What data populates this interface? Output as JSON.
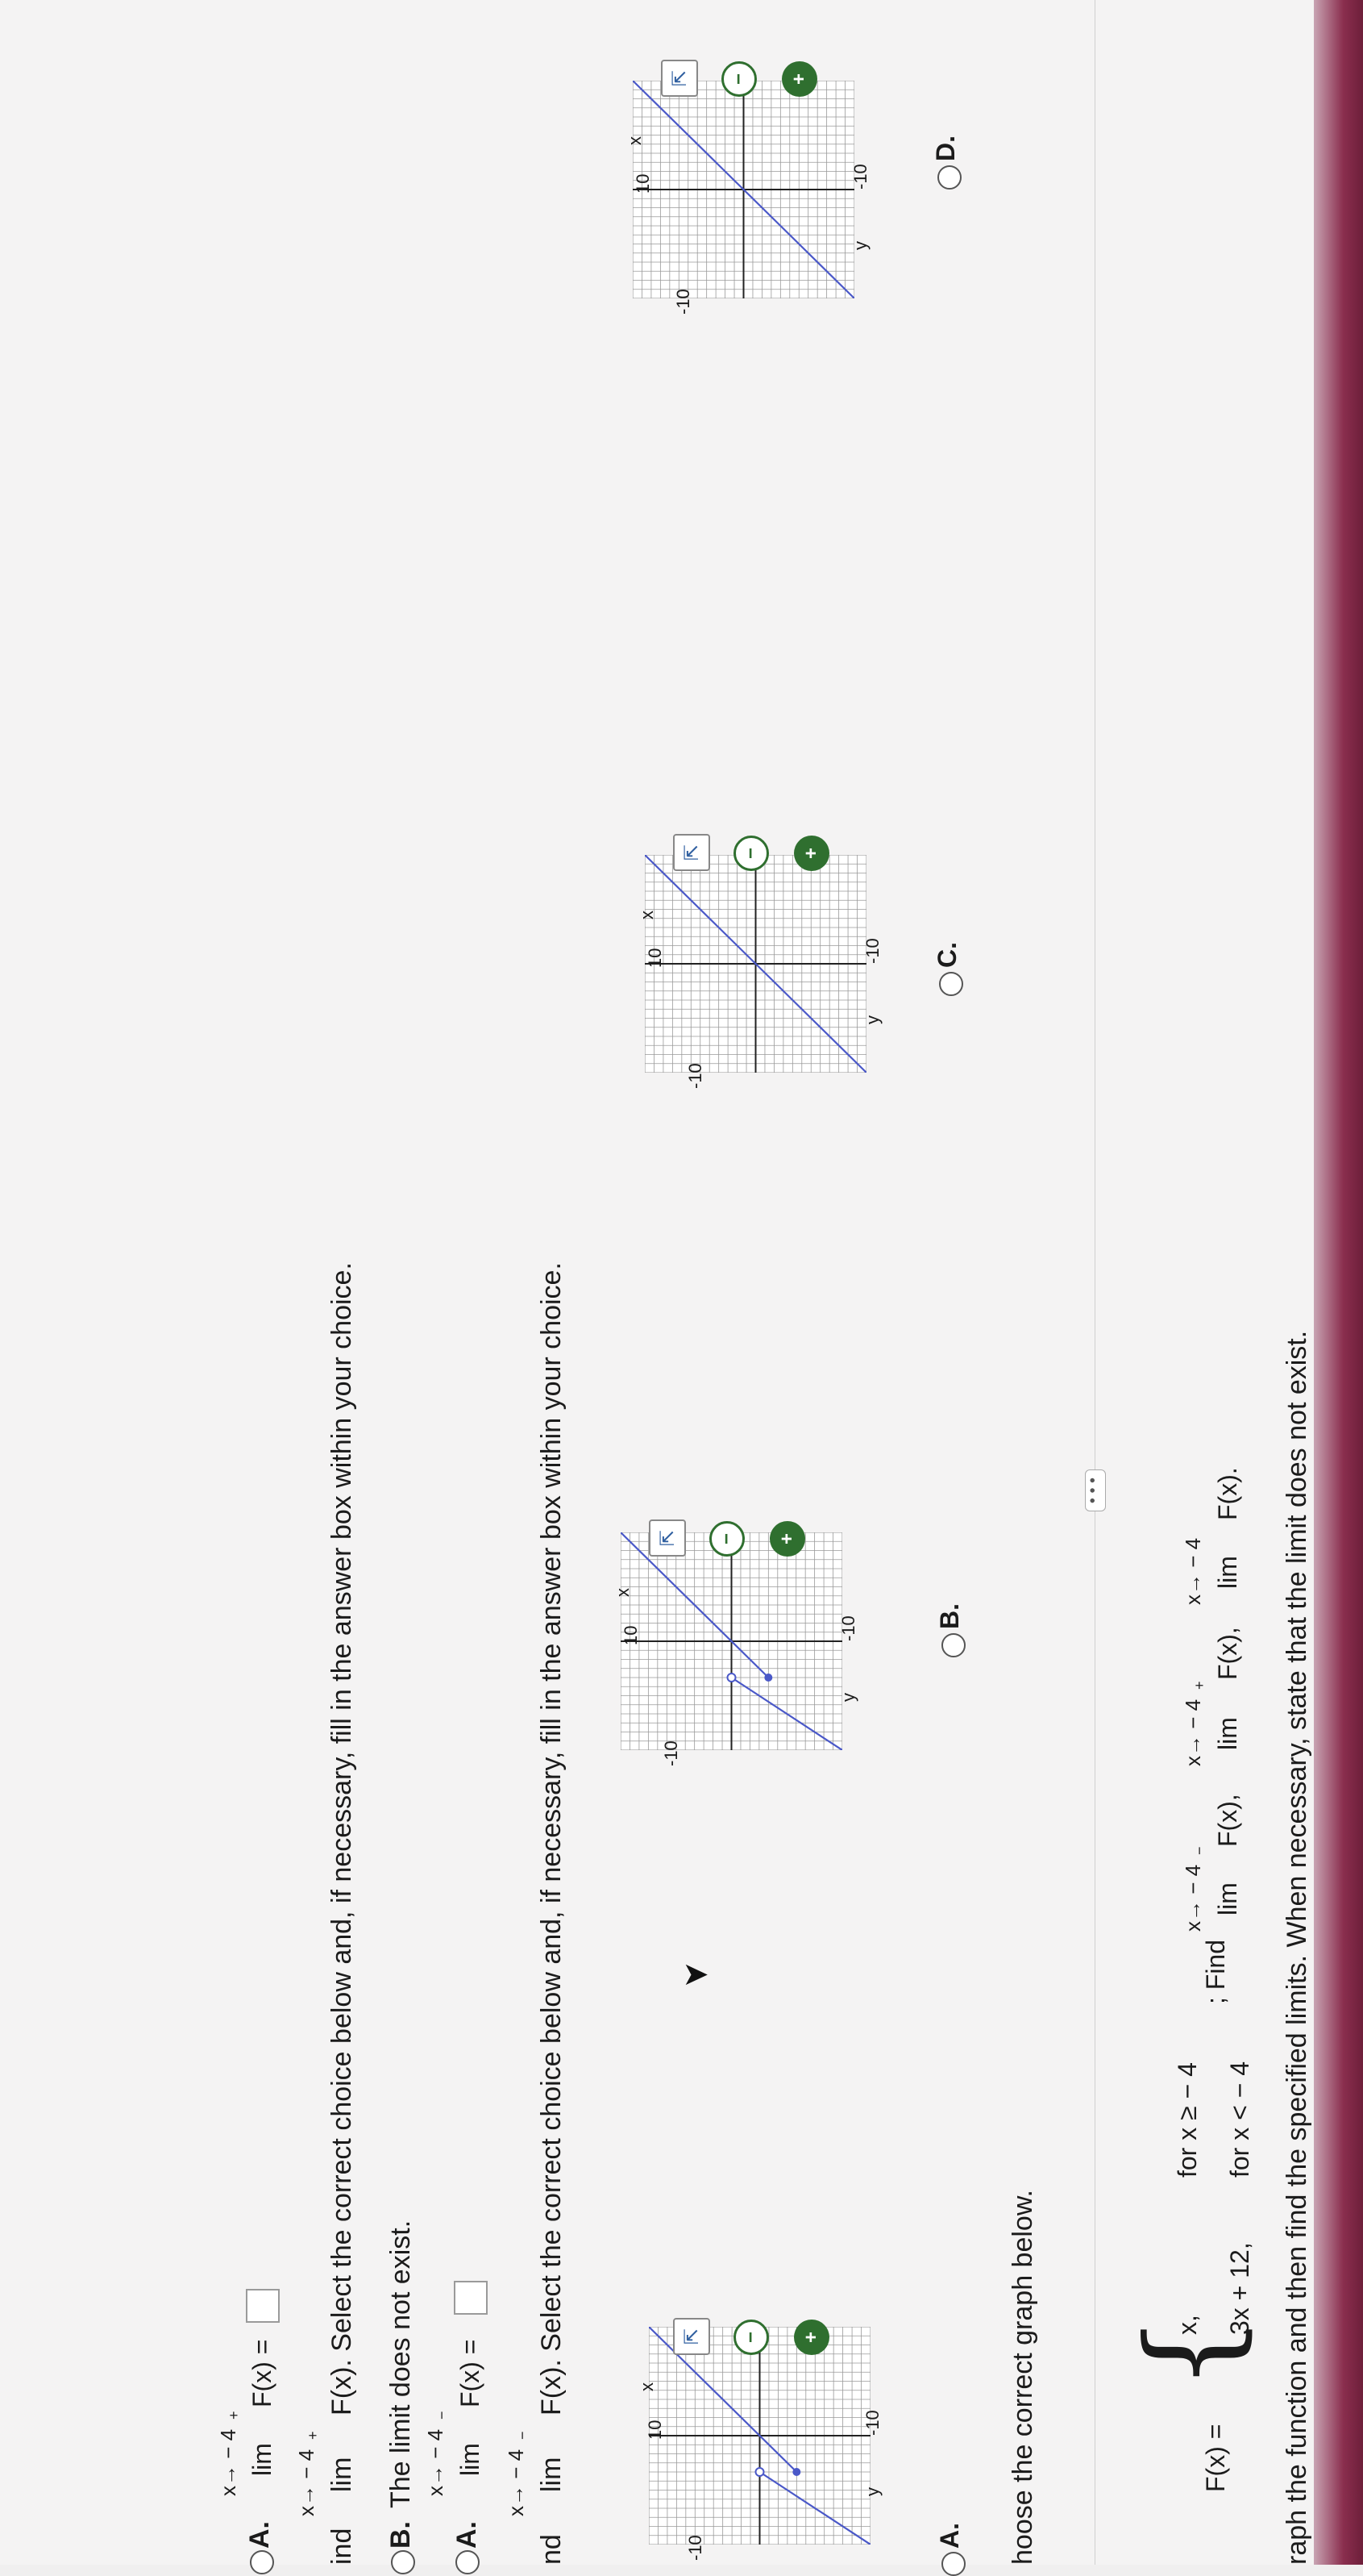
{
  "question": {
    "intro": "raph the function and then find the specified limits. When necessary, state that the limit does not exist.",
    "func_lhs": "F(x) =",
    "piece1_expr": "3x + 12,",
    "piece1_cond": "for x < − 4",
    "piece2_expr": "x,",
    "piece2_cond": "for x ≥ − 4",
    "find_label": "; Find",
    "lim1": "lim",
    "lim1_sub": "x→ − 4",
    "lim1_sup": "−",
    "lim1_fn": "F(x),",
    "lim2": "lim",
    "lim2_sub": "x→ − 4",
    "lim2_sup": "+",
    "lim2_fn": "F(x),",
    "lim3": "lim",
    "lim3_sub": "x→ − 4",
    "lim3_fn": "F(x)."
  },
  "more_button": "• • •",
  "part1": {
    "prompt": "hoose the correct graph below.",
    "options": [
      {
        "letter": "A.",
        "has_radio": false
      },
      {
        "letter": "B.",
        "has_radio": true
      },
      {
        "letter": "C.",
        "has_radio": true
      },
      {
        "letter": "D.",
        "has_radio": true
      }
    ],
    "axis": {
      "y_label": "y",
      "x_label": "x",
      "pos10": "10",
      "neg10": "-10"
    }
  },
  "part2": {
    "prompt_pre": "nd",
    "lim": "lim",
    "lim_sub": "x→ − 4",
    "lim_sup": "−",
    "prompt_post": "F(x). Select the correct choice below and, if necessary, fill in the answer box within your choice.",
    "optA_letter": "A.",
    "optA_lim": "lim",
    "optA_sub": "x→ − 4",
    "optA_sup": "−",
    "optA_fn": "F(x) =",
    "optB_letter": "B.",
    "optB_text": "The limit does not exist."
  },
  "part3": {
    "prompt_pre": "ind",
    "lim": "lim",
    "lim_sub": "x→ − 4",
    "lim_sup": "+",
    "prompt_post": "F(x). Select the correct choice below and, if necessary, fill in the answer box within your choice.",
    "optA_letter": "A.",
    "optA_lim": "lim",
    "optA_fn": "F(x) =",
    "optA_sub": "x→ − 4",
    "optA_sup": "+"
  },
  "icons": {
    "zoom_in": "+",
    "zoom_out": "−",
    "popout": "⇱"
  },
  "colors": {
    "graph_line": "#4a58c8",
    "grid": "#777777",
    "accent": "#2f6f2f",
    "header_bar": "#8a2e4e"
  }
}
